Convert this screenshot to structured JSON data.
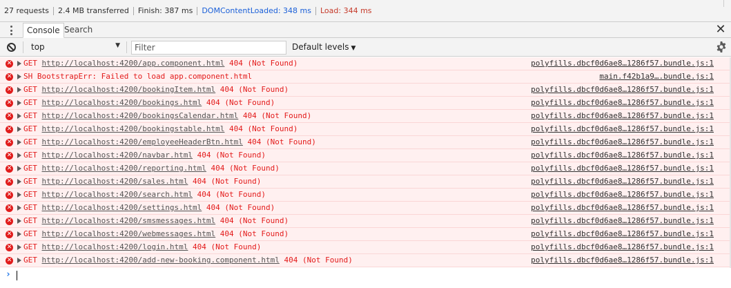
{
  "network_summary": {
    "requests": "27 requests",
    "transferred": "2.4 MB transferred",
    "finish": "Finish: 387 ms",
    "dom_content_loaded": "DOMContentLoaded: 348 ms",
    "load": "Load: 344 ms"
  },
  "drawer": {
    "tabs": [
      {
        "label": "Console",
        "active": true
      },
      {
        "label": "Search",
        "active": false
      }
    ]
  },
  "toolbar": {
    "context": "top",
    "filter_placeholder": "Filter",
    "levels_label": "Default levels"
  },
  "messages": [
    {
      "method": "GET",
      "url": "http://localhost:4200/app.component.html",
      "status": "404 (Not Found)",
      "source": "polyfills.dbcf0d6ae8…1286f57.bundle.js:1"
    },
    {
      "method": "",
      "text": "SH BootstrapErr: Failed to load app.component.html",
      "source": "main.f42b1a9….bundle.js:1"
    },
    {
      "method": "GET",
      "url": "http://localhost:4200/bookingItem.html",
      "status": "404 (Not Found)",
      "source": "polyfills.dbcf0d6ae8…1286f57.bundle.js:1"
    },
    {
      "method": "GET",
      "url": "http://localhost:4200/bookings.html",
      "status": "404 (Not Found)",
      "source": "polyfills.dbcf0d6ae8…1286f57.bundle.js:1"
    },
    {
      "method": "GET",
      "url": "http://localhost:4200/bookingsCalendar.html",
      "status": "404 (Not Found)",
      "source": "polyfills.dbcf0d6ae8…1286f57.bundle.js:1"
    },
    {
      "method": "GET",
      "url": "http://localhost:4200/bookingstable.html",
      "status": "404 (Not Found)",
      "source": "polyfills.dbcf0d6ae8…1286f57.bundle.js:1"
    },
    {
      "method": "GET",
      "url": "http://localhost:4200/employeeHeaderBtn.html",
      "status": "404 (Not Found)",
      "source": "polyfills.dbcf0d6ae8…1286f57.bundle.js:1"
    },
    {
      "method": "GET",
      "url": "http://localhost:4200/navbar.html",
      "status": "404 (Not Found)",
      "source": "polyfills.dbcf0d6ae8…1286f57.bundle.js:1"
    },
    {
      "method": "GET",
      "url": "http://localhost:4200/reporting.html",
      "status": "404 (Not Found)",
      "source": "polyfills.dbcf0d6ae8…1286f57.bundle.js:1"
    },
    {
      "method": "GET",
      "url": "http://localhost:4200/sales.html",
      "status": "404 (Not Found)",
      "source": "polyfills.dbcf0d6ae8…1286f57.bundle.js:1"
    },
    {
      "method": "GET",
      "url": "http://localhost:4200/search.html",
      "status": "404 (Not Found)",
      "source": "polyfills.dbcf0d6ae8…1286f57.bundle.js:1"
    },
    {
      "method": "GET",
      "url": "http://localhost:4200/settings.html",
      "status": "404 (Not Found)",
      "source": "polyfills.dbcf0d6ae8…1286f57.bundle.js:1"
    },
    {
      "method": "GET",
      "url": "http://localhost:4200/smsmessages.html",
      "status": "404 (Not Found)",
      "source": "polyfills.dbcf0d6ae8…1286f57.bundle.js:1"
    },
    {
      "method": "GET",
      "url": "http://localhost:4200/webmessages.html",
      "status": "404 (Not Found)",
      "source": "polyfills.dbcf0d6ae8…1286f57.bundle.js:1"
    },
    {
      "method": "GET",
      "url": "http://localhost:4200/login.html",
      "status": "404 (Not Found)",
      "source": "polyfills.dbcf0d6ae8…1286f57.bundle.js:1"
    },
    {
      "method": "GET",
      "url": "http://localhost:4200/add-new-booking.component.html",
      "status": "404 (Not Found)",
      "source": "polyfills.dbcf0d6ae8…1286f57.bundle.js:1"
    }
  ],
  "prompt_symbol": "›",
  "colors": {
    "error_text": "#e31a1a",
    "error_bg": "#fff0f0",
    "dom_content_loaded": "#1a5fd8",
    "load": "#c53929"
  },
  "icons": {
    "drawer_menu": "kebab-menu-icon",
    "close": "close-icon",
    "clear": "clear-console-icon",
    "settings": "gear-icon",
    "error": "error-icon",
    "expand": "expand-triangle-icon"
  }
}
